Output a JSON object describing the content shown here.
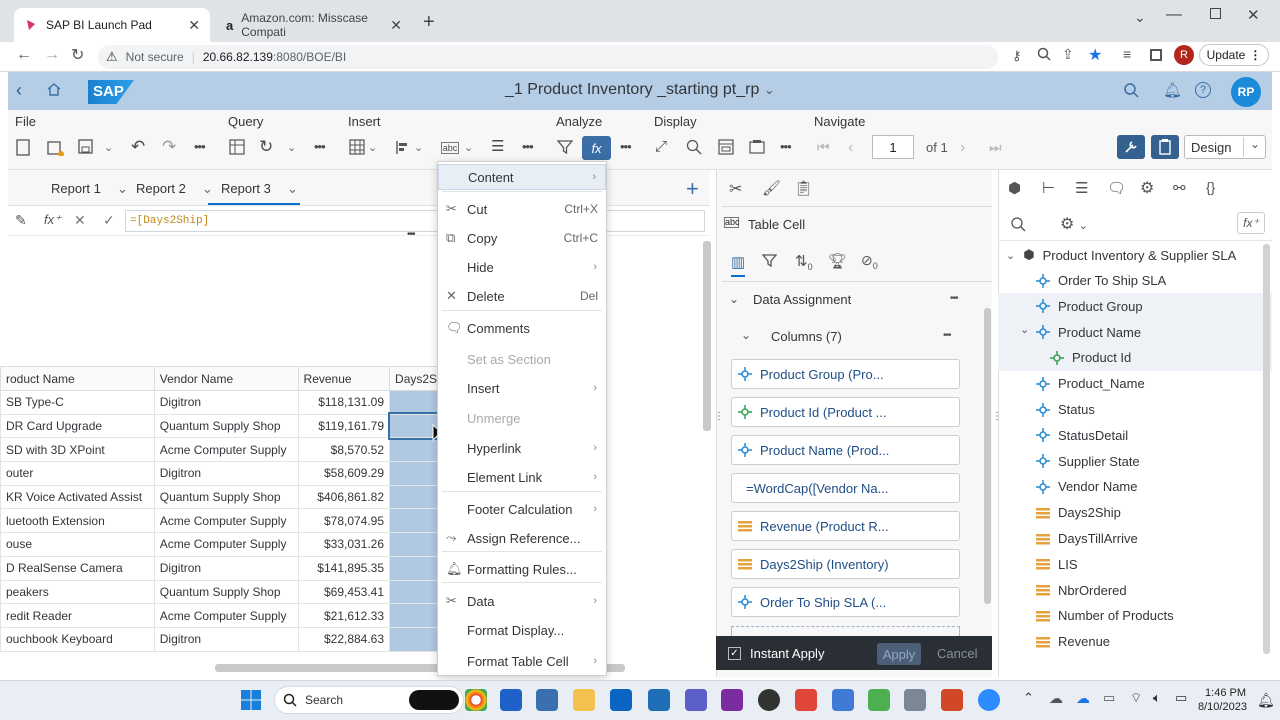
{
  "browser": {
    "tabs": [
      {
        "title": "SAP BI Launch Pad",
        "active": true
      },
      {
        "title": "Amazon.com: Misscase Compati",
        "active": false
      }
    ],
    "url_security": "Not secure",
    "url_host": "20.66.82.139",
    "url_rest": ":8080/BOE/BI",
    "profile_initial": "R",
    "update_label": "Update"
  },
  "shell": {
    "logo": "SAP",
    "title": "_1 Product Inventory _starting pt_rp",
    "avatar": "RP"
  },
  "toolbar": {
    "groups": [
      "File",
      "Query",
      "Insert",
      "Analyze",
      "Display",
      "Navigate"
    ],
    "page": "1",
    "page_of": "of 1",
    "design_label": "Design"
  },
  "reports": {
    "tabs": [
      "Report 1",
      "Report 2",
      "Report 3"
    ],
    "active": "Report 3"
  },
  "formula": {
    "value": "=[Days2Ship]"
  },
  "table": {
    "headers": [
      "roduct Name",
      "Vendor Name",
      "Revenue",
      "Days2S"
    ],
    "rows": [
      [
        "SB Type-C",
        "Digitron",
        "$118,131.09",
        ""
      ],
      [
        "DR Card Upgrade",
        "Quantum Supply Shop",
        "$119,161.79",
        ""
      ],
      [
        "SD with 3D XPoint",
        "Acme Computer Supply",
        "$8,570.52",
        ""
      ],
      [
        "outer",
        "Digitron",
        "$58,609.29",
        ""
      ],
      [
        "KR Voice Activated Assist",
        "Quantum Supply Shop",
        "$406,861.82",
        ""
      ],
      [
        "luetooth Extension",
        "Acme Computer Supply",
        "$78,074.95",
        ""
      ],
      [
        "ouse",
        "Acme Computer Supply",
        "$33,031.26",
        ""
      ],
      [
        "D RealSense Camera",
        "Digitron",
        "$141,895.35",
        ""
      ],
      [
        "peakers",
        "Quantum Supply Shop",
        "$69,453.41",
        ""
      ],
      [
        "redit Reader",
        "Acme Computer Supply",
        "$21,612.33",
        ""
      ],
      [
        "ouchbook Keyboard",
        "Digitron",
        "$22,884.63",
        ""
      ]
    ]
  },
  "context_menu": {
    "items": [
      {
        "label": "Content",
        "shortcut": "",
        "submenu": true,
        "disabled": false
      },
      {
        "label": "Cut",
        "shortcut": "Ctrl+X",
        "submenu": false,
        "disabled": false
      },
      {
        "label": "Copy",
        "shortcut": "Ctrl+C",
        "submenu": false,
        "disabled": false
      },
      {
        "label": "Hide",
        "shortcut": "",
        "submenu": true,
        "disabled": false
      },
      {
        "label": "Delete",
        "shortcut": "Del",
        "submenu": false,
        "disabled": false
      },
      {
        "label": "Comments",
        "shortcut": "",
        "submenu": false,
        "disabled": false
      },
      {
        "label": "Set as Section",
        "shortcut": "",
        "submenu": false,
        "disabled": true
      },
      {
        "label": "Insert",
        "shortcut": "",
        "submenu": true,
        "disabled": false
      },
      {
        "label": "Unmerge",
        "shortcut": "",
        "submenu": false,
        "disabled": true
      },
      {
        "label": "Hyperlink",
        "shortcut": "",
        "submenu": true,
        "disabled": false
      },
      {
        "label": "Element Link",
        "shortcut": "",
        "submenu": true,
        "disabled": false
      },
      {
        "label": "Footer Calculation",
        "shortcut": "",
        "submenu": true,
        "disabled": false
      },
      {
        "label": "Assign Reference...",
        "shortcut": "",
        "submenu": false,
        "disabled": false
      },
      {
        "label": "Formatting Rules...",
        "shortcut": "",
        "submenu": false,
        "disabled": false
      },
      {
        "label": "Data",
        "shortcut": "",
        "submenu": true,
        "disabled": false
      },
      {
        "label": "Format Display...",
        "shortcut": "",
        "submenu": false,
        "disabled": false
      },
      {
        "label": "Format Table Cell",
        "shortcut": "",
        "submenu": true,
        "disabled": false
      }
    ]
  },
  "mid_panel": {
    "element_type": "Table Cell",
    "section_title": "Data Assignment",
    "columns_label": "Columns (7)",
    "filter_count": "0",
    "sort_count": "0",
    "items": [
      {
        "label": "Product Group (Pro...",
        "kind": "dimension"
      },
      {
        "label": "Product Id (Product ...",
        "kind": "detail"
      },
      {
        "label": "Product Name (Prod...",
        "kind": "dimension"
      },
      {
        "label": "=WordCap([Vendor Na...",
        "kind": "formula"
      },
      {
        "label": "Revenue (Product R...",
        "kind": "measure"
      },
      {
        "label": "Days2Ship (Inventory)",
        "kind": "measure"
      },
      {
        "label": "Order To Ship SLA (...",
        "kind": "dimension"
      }
    ],
    "instant_apply": "Instant Apply",
    "apply": "Apply",
    "cancel": "Cancel"
  },
  "right_panel": {
    "root": "Product Inventory & Supplier SLA",
    "items": [
      {
        "label": "Order To Ship SLA",
        "kind": "dimension",
        "indent": 1
      },
      {
        "label": "Product Group",
        "kind": "dimension",
        "indent": 1
      },
      {
        "label": "Product Name",
        "kind": "dimension",
        "indent": 1
      },
      {
        "label": "Product Id",
        "kind": "detail",
        "indent": 2
      },
      {
        "label": "Product_Name",
        "kind": "dimension",
        "indent": 1
      },
      {
        "label": "Status",
        "kind": "dimension",
        "indent": 1
      },
      {
        "label": "StatusDetail",
        "kind": "dimension",
        "indent": 1
      },
      {
        "label": "Supplier State",
        "kind": "dimension",
        "indent": 1
      },
      {
        "label": "Vendor Name",
        "kind": "dimension",
        "indent": 1
      },
      {
        "label": "Days2Ship",
        "kind": "measure",
        "indent": 1
      },
      {
        "label": "DaysTillArrive",
        "kind": "measure",
        "indent": 1
      },
      {
        "label": "LIS",
        "kind": "measure",
        "indent": 1
      },
      {
        "label": "NbrOrdered",
        "kind": "measure",
        "indent": 1
      },
      {
        "label": "Number of Products",
        "kind": "measure",
        "indent": 1
      },
      {
        "label": "Revenue",
        "kind": "measure",
        "indent": 1
      }
    ]
  },
  "taskbar": {
    "search_placeholder": "Search",
    "time": "1:46 PM",
    "date": "8/10/2023"
  },
  "colors": {
    "shell": "#b6cde6",
    "accent": "#0a6ed1",
    "dimension": "#2f8fd6",
    "detail": "#3da35a",
    "measure": "#e6a23c",
    "selection": "#b0c8e0"
  }
}
